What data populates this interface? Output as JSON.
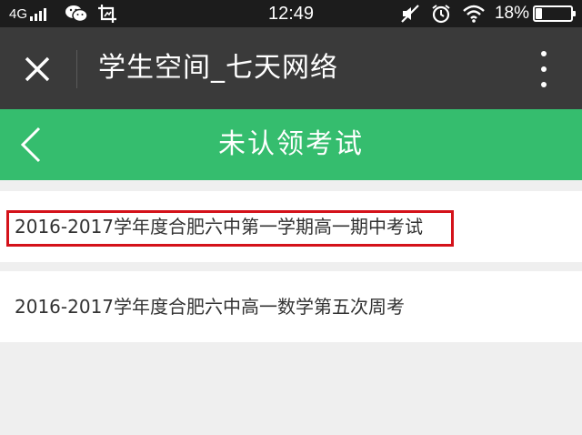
{
  "status_bar": {
    "network": "4G",
    "time": "12:49",
    "battery_text": "18%",
    "battery_level": 0.18,
    "icons": [
      "signal-icon",
      "wechat-icon",
      "screenshot-icon",
      "mute-icon",
      "alarm-icon",
      "wifi-icon",
      "battery-icon"
    ]
  },
  "webview": {
    "title": "学生空间_七天网络",
    "icons": [
      "close-icon",
      "more-icon"
    ]
  },
  "header": {
    "title": "未认领考试",
    "icons": [
      "back-arrow-icon"
    ],
    "color": "#35bd6e"
  },
  "exams": [
    {
      "name": "2016-2017学年度合肥六中第一学期高一期中考试",
      "highlighted": true
    },
    {
      "name": "2016-2017学年度合肥六中高一数学第五次周考",
      "highlighted": false
    }
  ],
  "colors": {
    "status_bar": "#1c1c1c",
    "title_bar": "#3a3a3a",
    "background": "#efefef",
    "highlight": "#d4121a"
  }
}
